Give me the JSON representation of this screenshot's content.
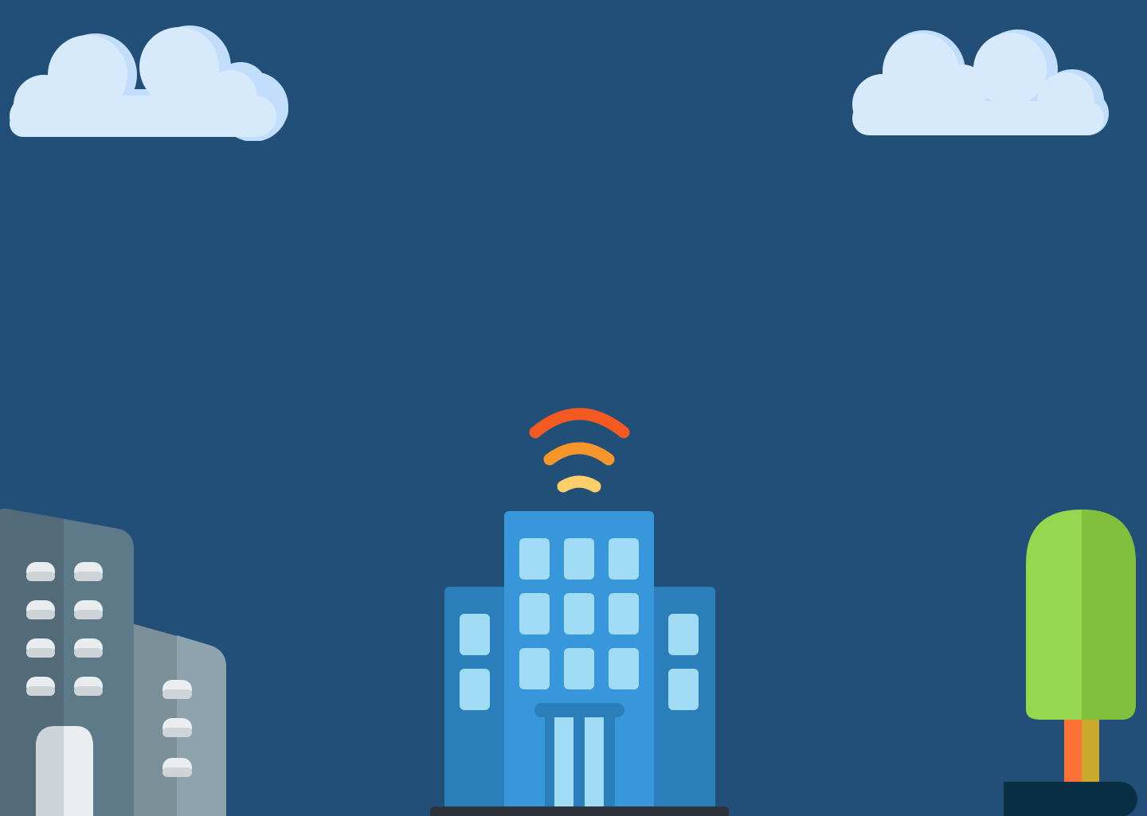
{
  "scene": {
    "background": "#214f78",
    "elements": {
      "left_cloud": "cloud-icon",
      "right_cloud": "cloud-icon",
      "left_building": "office-building-icon",
      "center_building": "office-building-icon",
      "wifi_signal": "wifi-signal-icon",
      "tree": "tree-icon"
    }
  },
  "colors": {
    "cloud_light": "#d7eafc",
    "cloud_shadow": "#c2defc",
    "building_blue": "#3897db",
    "building_blue_dark": "#2a7fba",
    "window_blue": "#a0ddf5",
    "building_grey": "#5e7a89",
    "building_grey_dark": "#536b79",
    "building_grey_light": "#8ea3ad",
    "window_white": "#e9edf0",
    "wifi_red": "#f25a22",
    "wifi_orange": "#f6962a",
    "wifi_yellow": "#fecf69",
    "tree_green": "#95d74f",
    "tree_green_dark": "#81bf3c",
    "trunk_orange": "#ff7137",
    "trunk_gold": "#cba92c",
    "ground_dark": "#082f43"
  }
}
